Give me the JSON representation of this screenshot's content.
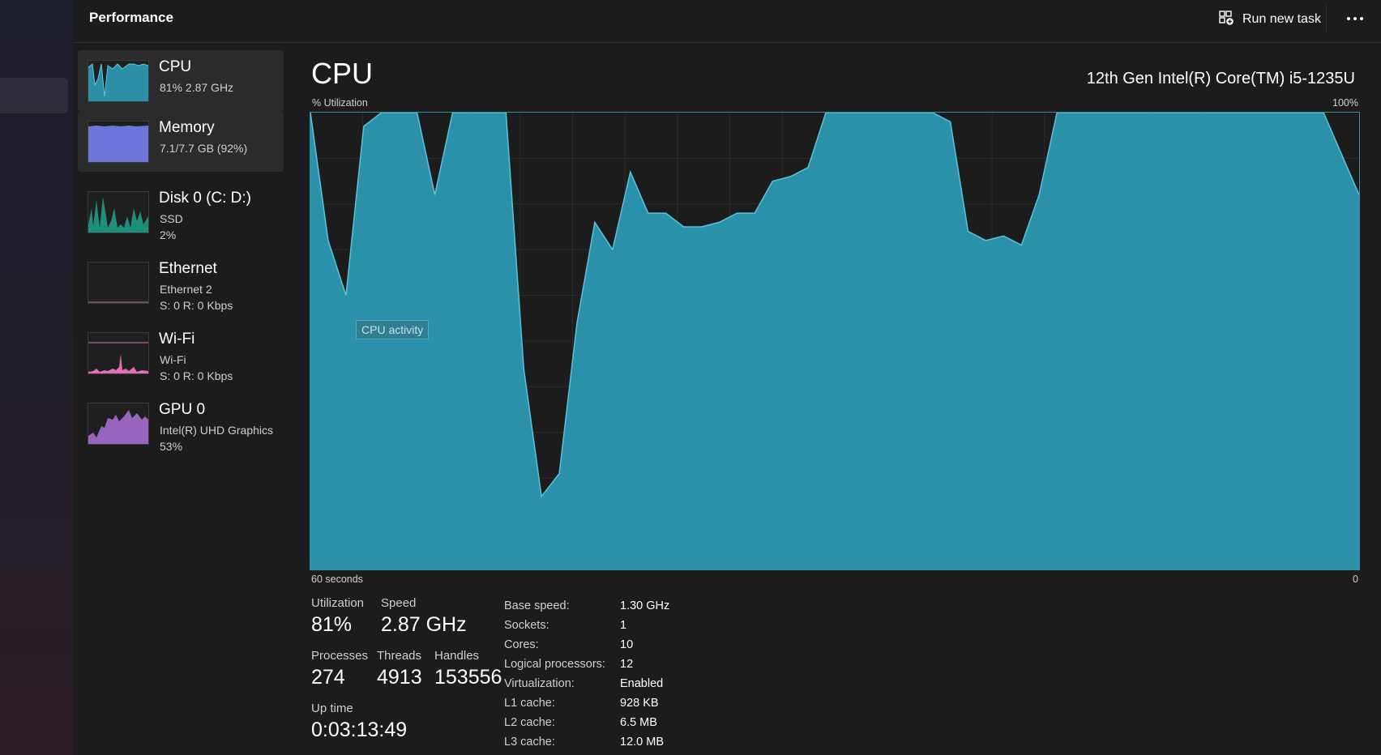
{
  "header": {
    "title": "Performance",
    "run_new_task": "Run new task"
  },
  "colors": {
    "cpu": "#2d9bb7",
    "memory": "#6c75d8",
    "disk": "#1ea38c",
    "wifi": "#e070b8",
    "gpu": "#a46ccf"
  },
  "sidebar": {
    "items": [
      {
        "title": "CPU",
        "lines": [
          "81%  2.87 GHz"
        ]
      },
      {
        "title": "Memory",
        "lines": [
          "7.1/7.7 GB (92%)"
        ]
      },
      {
        "title": "Disk 0 (C: D:)",
        "lines": [
          "SSD",
          "2%"
        ]
      },
      {
        "title": "Ethernet",
        "lines": [
          "Ethernet 2",
          "S: 0  R: 0 Kbps"
        ]
      },
      {
        "title": "Wi-Fi",
        "lines": [
          "Wi-Fi",
          "S: 0  R: 0 Kbps"
        ]
      },
      {
        "title": "GPU 0",
        "lines": [
          "Intel(R) UHD Graphics",
          "53%"
        ]
      }
    ]
  },
  "main": {
    "title": "CPU",
    "model": "12th Gen Intel(R) Core(TM) i5-1235U",
    "graph_label_left": "% Utilization",
    "graph_label_right": "100%",
    "time_left": "60 seconds",
    "time_right": "0",
    "tooltip": "CPU activity"
  },
  "stats": {
    "utilization": {
      "label": "Utilization",
      "value": "81%"
    },
    "speed": {
      "label": "Speed",
      "value": "2.87 GHz"
    },
    "processes": {
      "label": "Processes",
      "value": "274"
    },
    "threads": {
      "label": "Threads",
      "value": "4913"
    },
    "handles": {
      "label": "Handles",
      "value": "153556"
    },
    "uptime": {
      "label": "Up time",
      "value": "0:03:13:49"
    }
  },
  "specs": [
    {
      "key": "Base speed:",
      "value": "1.30 GHz"
    },
    {
      "key": "Sockets:",
      "value": "1"
    },
    {
      "key": "Cores:",
      "value": "10"
    },
    {
      "key": "Logical processors:",
      "value": "12"
    },
    {
      "key": "Virtualization:",
      "value": "Enabled"
    },
    {
      "key": "L1 cache:",
      "value": "928 KB"
    },
    {
      "key": "L2 cache:",
      "value": "6.5 MB"
    },
    {
      "key": "L3 cache:",
      "value": "12.0 MB"
    }
  ],
  "chart_data": {
    "type": "area",
    "ylabel": "% Utilization",
    "ylim": [
      0,
      100
    ],
    "x_range_seconds": [
      60,
      0
    ],
    "grid": true,
    "values": [
      100,
      72,
      60,
      97,
      100,
      100,
      100,
      82,
      100,
      100,
      100,
      100,
      44,
      16,
      21,
      54,
      76,
      70,
      87,
      78,
      78,
      75,
      75,
      76,
      78,
      78,
      85,
      86,
      88,
      100,
      100,
      100,
      100,
      100,
      100,
      100,
      98,
      74,
      72,
      73,
      71,
      82,
      100,
      100,
      100,
      100,
      100,
      100,
      100,
      100,
      100,
      100,
      100,
      100,
      100,
      100,
      100,
      100,
      91,
      82
    ]
  }
}
